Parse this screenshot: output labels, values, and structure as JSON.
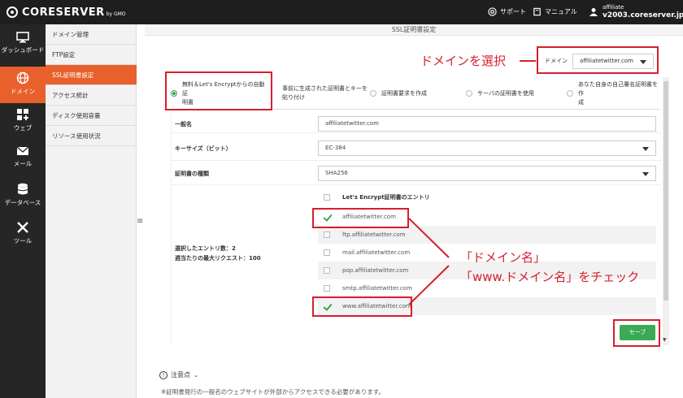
{
  "topbar": {
    "logo_text": "CORESERVER",
    "logo_suffix": "by GMO",
    "support": "サポート",
    "manual": "マニュアル",
    "user_name": "affiliate",
    "user_server": "v2003.coreserver.jp"
  },
  "rail": {
    "items": [
      {
        "label": "ダッシュボード",
        "icon": "monitor-icon"
      },
      {
        "label": "ドメイン",
        "icon": "globe-icon"
      },
      {
        "label": "ウェブ",
        "icon": "web-icon"
      },
      {
        "label": "メール",
        "icon": "mail-icon"
      },
      {
        "label": "データベース",
        "icon": "database-icon"
      },
      {
        "label": "ツール",
        "icon": "tools-icon"
      }
    ],
    "active_label": "ドメイン"
  },
  "menu": {
    "items": [
      "ドメイン管理",
      "FTP設定",
      "SSL証明書設定",
      "アクセス統計",
      "ディスク使用容量",
      "リソース使用状況"
    ],
    "active": "SSL証明書設定"
  },
  "page": {
    "title": "SSL証明書設定",
    "domain_label": "ドメイン",
    "domain_value": "affiliatetwitter.com"
  },
  "tabs": [
    {
      "label_line1": "無料＆Let's Encryptからの自動証",
      "label_line2": "明書",
      "selected": true
    },
    {
      "label_line1": "事前に生成された証明書とキーを",
      "label_line2": "貼り付け",
      "selected": false
    },
    {
      "label_line1": "証明書要求を作成",
      "label_line2": "",
      "selected": false
    },
    {
      "label_line1": "サーバの証明書を使用",
      "label_line2": "",
      "selected": false
    },
    {
      "label_line1": "あなた自身の自己署名証明書を作",
      "label_line2": "成",
      "selected": false
    }
  ],
  "form": {
    "common_name_label": "一般名",
    "common_name_value": "affiliatetwitter.com",
    "key_size_label": "キーサイズ（ビット）",
    "key_size_value": "EC-384",
    "cert_type_label": "証明書の種類",
    "cert_type_value": "SHA256",
    "entries_header": "Let's Encrypt証明書のエントリ",
    "selected_count": "選択したエントリ数：2",
    "weekly_max": "週当たりの最大リクエスト：100",
    "entries": [
      {
        "name": "affiliatetwitter.com",
        "checked": true
      },
      {
        "name": "ftp.affiliatetwitter.com",
        "checked": false
      },
      {
        "name": "mail.affiliatetwitter.com",
        "checked": false
      },
      {
        "name": "pop.affiliatetwitter.com",
        "checked": false
      },
      {
        "name": "smtp.affiliatetwitter.com",
        "checked": false
      },
      {
        "name": "www.affiliatetwitter.com",
        "checked": true
      }
    ],
    "save_label": "セーブ"
  },
  "notice": {
    "title": "注意点",
    "text": "※証明書発行の一般名のウェブサイトが外部からアクセスできる必要があります。"
  },
  "annotations": {
    "select_domain": "ドメインを選択",
    "check_line1": "「ドメイン名」",
    "check_line2": "「www.ドメイン名」をチェック",
    "color": "#d81e2c"
  },
  "colors": {
    "accent": "#e8602c",
    "save_green": "#3aaa55",
    "topbar": "#1e1e1e"
  }
}
